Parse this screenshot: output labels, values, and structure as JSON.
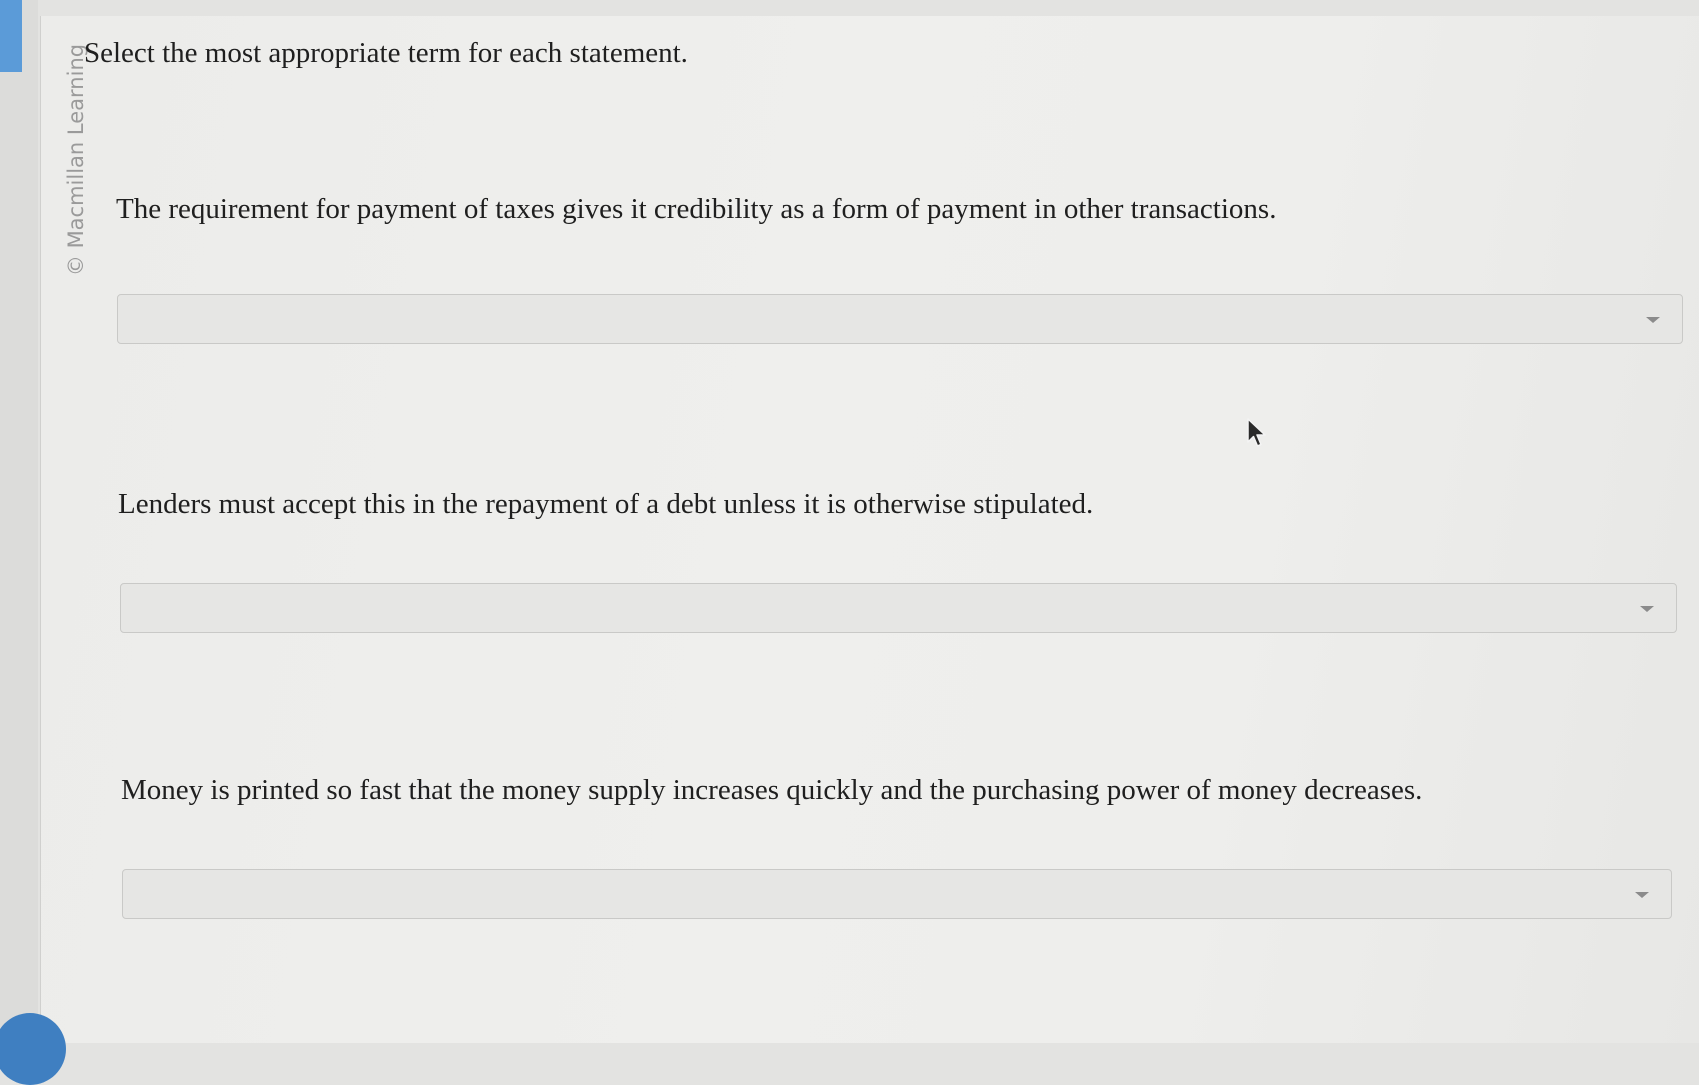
{
  "watermark": "© Macmillan Learning",
  "instruction": "Select the most appropriate term for each statement.",
  "questions": [
    {
      "statement": "The requirement for payment of taxes gives it credibility as a form of payment in other transactions.",
      "selected": ""
    },
    {
      "statement": "Lenders must accept this in the repayment of a debt unless it is otherwise stipulated.",
      "selected": ""
    },
    {
      "statement": "Money is printed so fast that the money supply increases quickly and the purchasing power of money decreases.",
      "selected": ""
    }
  ],
  "icons": {
    "dropdown": "chevron-down-icon",
    "cursor": "mouse-pointer-icon"
  },
  "colors": {
    "accent": "#3f7fc1",
    "text": "#1f1f1f",
    "dropdown_bg": "#e6e6e4"
  }
}
